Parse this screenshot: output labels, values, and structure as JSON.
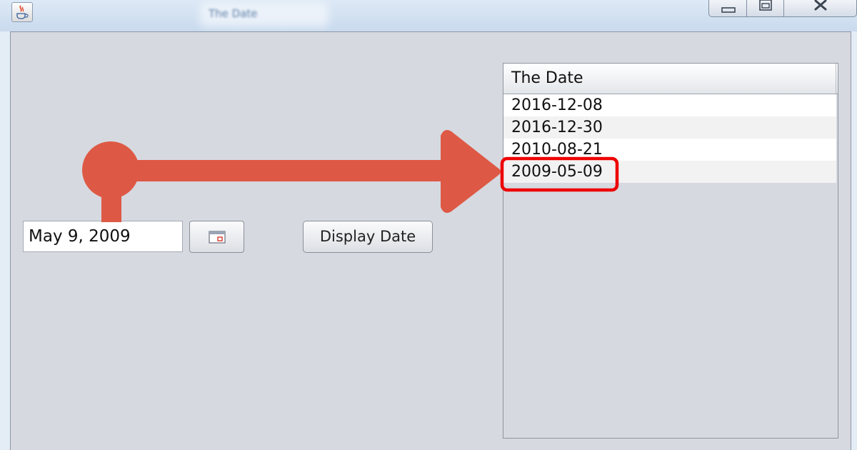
{
  "window": {
    "title": "The Date"
  },
  "form": {
    "date_value": "May 9, 2009",
    "calendar_button_icon": "calendar-icon",
    "display_button_label": "Display Date"
  },
  "table": {
    "column_header": "The Date",
    "rows": [
      "2016-12-08",
      "2016-12-30",
      "2010-08-21",
      "2009-05-09"
    ],
    "highlighted_row_index": 3
  },
  "annotation": {
    "arrow_color": "#de5945",
    "highlight_color": "#ee0000"
  },
  "icons": {
    "app": "java-coffee-cup-icon",
    "minimize": "minimize-icon",
    "maximize": "maximize-icon",
    "close": "close-icon"
  }
}
